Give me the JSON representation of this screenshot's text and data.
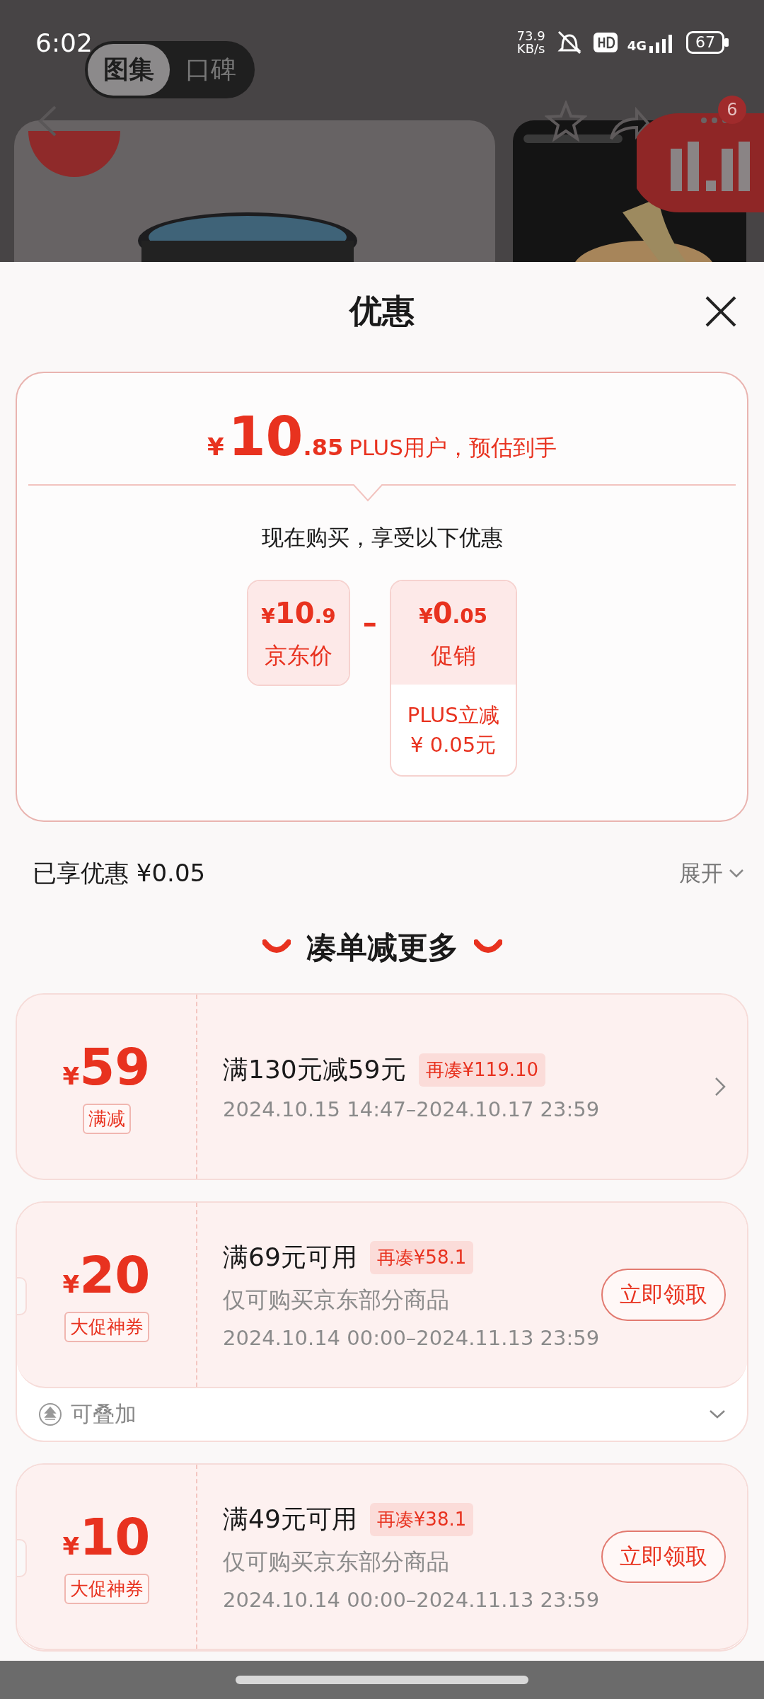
{
  "status_bar": {
    "time": "6:02",
    "net_speed": "73.9",
    "net_unit": "KB/s",
    "network": "4G",
    "battery": "67"
  },
  "gallery_tabs": [
    {
      "label": "图集",
      "selected": true
    },
    {
      "label": "口碑",
      "selected": false
    }
  ],
  "header": {
    "cart_count": "6"
  },
  "sheet": {
    "title": "优惠"
  },
  "estimate": {
    "currency": "¥",
    "integer": "10",
    "decimal": ".85",
    "note": "PLUS用户，预估到手"
  },
  "breakdown": {
    "heading": "现在购买，享受以下优惠",
    "operator": "–",
    "terms": [
      {
        "currency": "¥",
        "integer": "10",
        "decimal": ".9",
        "label": "京东价"
      },
      {
        "currency": "¥",
        "integer": "0",
        "decimal": ".05",
        "label": "促销",
        "details": [
          "PLUS立减",
          "¥ 0.05元"
        ]
      }
    ]
  },
  "enjoyed": {
    "label": "已享优惠 ¥0.05",
    "toggle": "展开"
  },
  "section_title": "凑单减更多",
  "coupons": [
    {
      "kind": "link",
      "currency": "¥",
      "amount": "59",
      "tag": "满减",
      "condition": "满130元减59元",
      "gap": "再凑¥119.10",
      "validity": "2024.10.15 14:47–2024.10.17 23:59"
    },
    {
      "kind": "claim",
      "currency": "¥",
      "amount": "20",
      "tag": "大促神券",
      "condition": "满69元可用",
      "gap": "再凑¥58.1",
      "scope": "仅可购买京东部分商品",
      "validity": "2024.10.14 00:00–2024.11.13 23:59",
      "action": "立即领取",
      "footer": "可叠加"
    },
    {
      "kind": "claim",
      "currency": "¥",
      "amount": "10",
      "tag": "大促神券",
      "condition": "满49元可用",
      "gap": "再凑¥38.1",
      "scope": "仅可购买京东部分商品",
      "validity": "2024.10.14 00:00–2024.11.13 23:59",
      "action": "立即领取"
    }
  ]
}
